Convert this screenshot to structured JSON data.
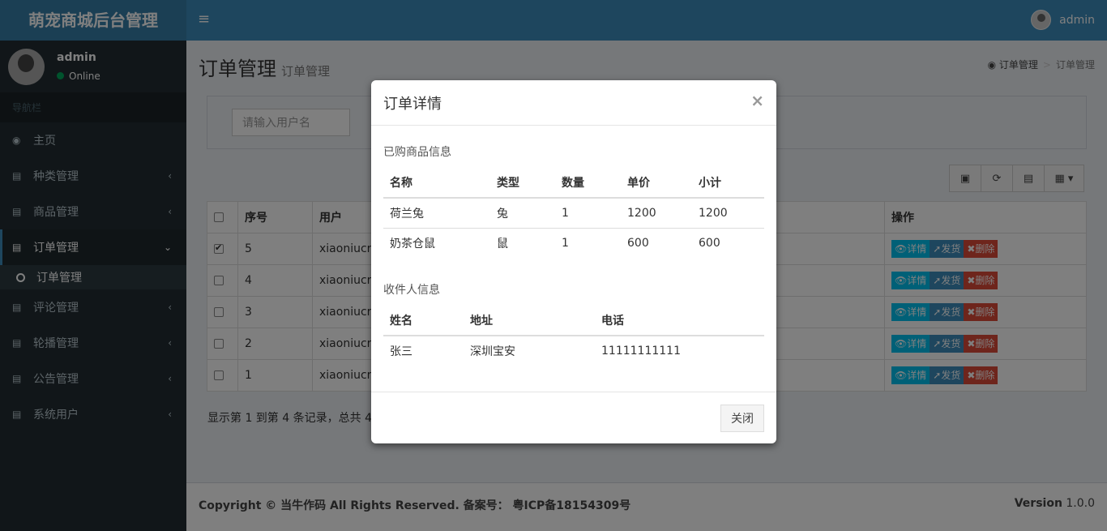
{
  "app": {
    "logo": "萌宠商城后台管理",
    "toggle": "≡",
    "user": "admin"
  },
  "sidebar": {
    "name": "admin",
    "status": "Online",
    "header": "导航栏",
    "items": [
      {
        "label": "主页"
      },
      {
        "label": "种类管理"
      },
      {
        "label": "商品管理"
      },
      {
        "label": "订单管理"
      },
      {
        "label": "订单管理"
      },
      {
        "label": "评论管理"
      },
      {
        "label": "轮播管理"
      },
      {
        "label": "公告管理"
      },
      {
        "label": "系统用户"
      }
    ]
  },
  "page": {
    "title": "订单管理",
    "subtitle": "订单管理",
    "crumb": [
      "订单管理",
      "订单管理"
    ],
    "search_placeholder": "请输入用户名"
  },
  "table": {
    "headers": [
      "序号",
      "用户",
      "操作"
    ],
    "rows": [
      {
        "id": "5",
        "user": "xiaoniucr",
        "checked": true
      },
      {
        "id": "4",
        "user": "xiaoniucr",
        "checked": false
      },
      {
        "id": "3",
        "user": "xiaoniucr",
        "checked": false
      },
      {
        "id": "2",
        "user": "xiaoniucr",
        "checked": false
      },
      {
        "id": "1",
        "user": "xiaoniucr",
        "checked": false
      }
    ],
    "actions": {
      "detail": "详情",
      "ship": "发货",
      "delete": "删除"
    },
    "info": "显示第 1 到第 4 条记录，总共 4"
  },
  "footer": {
    "copyright": "Copyright © 当牛作码 All Rights Reserved. 备案号： 粤ICP备18154309号",
    "version_label": "Version",
    "version": "1.0.0"
  },
  "modal": {
    "title": "订单详情",
    "close_x": "×",
    "goods_title": "已购商品信息",
    "goods_headers": [
      "名称",
      "类型",
      "数量",
      "单价",
      "小计"
    ],
    "goods": [
      [
        "荷兰兔",
        "兔",
        "1",
        "1200",
        "1200"
      ],
      [
        "奶茶仓鼠",
        "鼠",
        "1",
        "600",
        "600"
      ]
    ],
    "recv_title": "收件人信息",
    "recv_headers": [
      "姓名",
      "地址",
      "电话"
    ],
    "recv": [
      [
        "张三",
        "深圳宝安",
        "11111111111"
      ]
    ],
    "close_button": "关闭"
  }
}
